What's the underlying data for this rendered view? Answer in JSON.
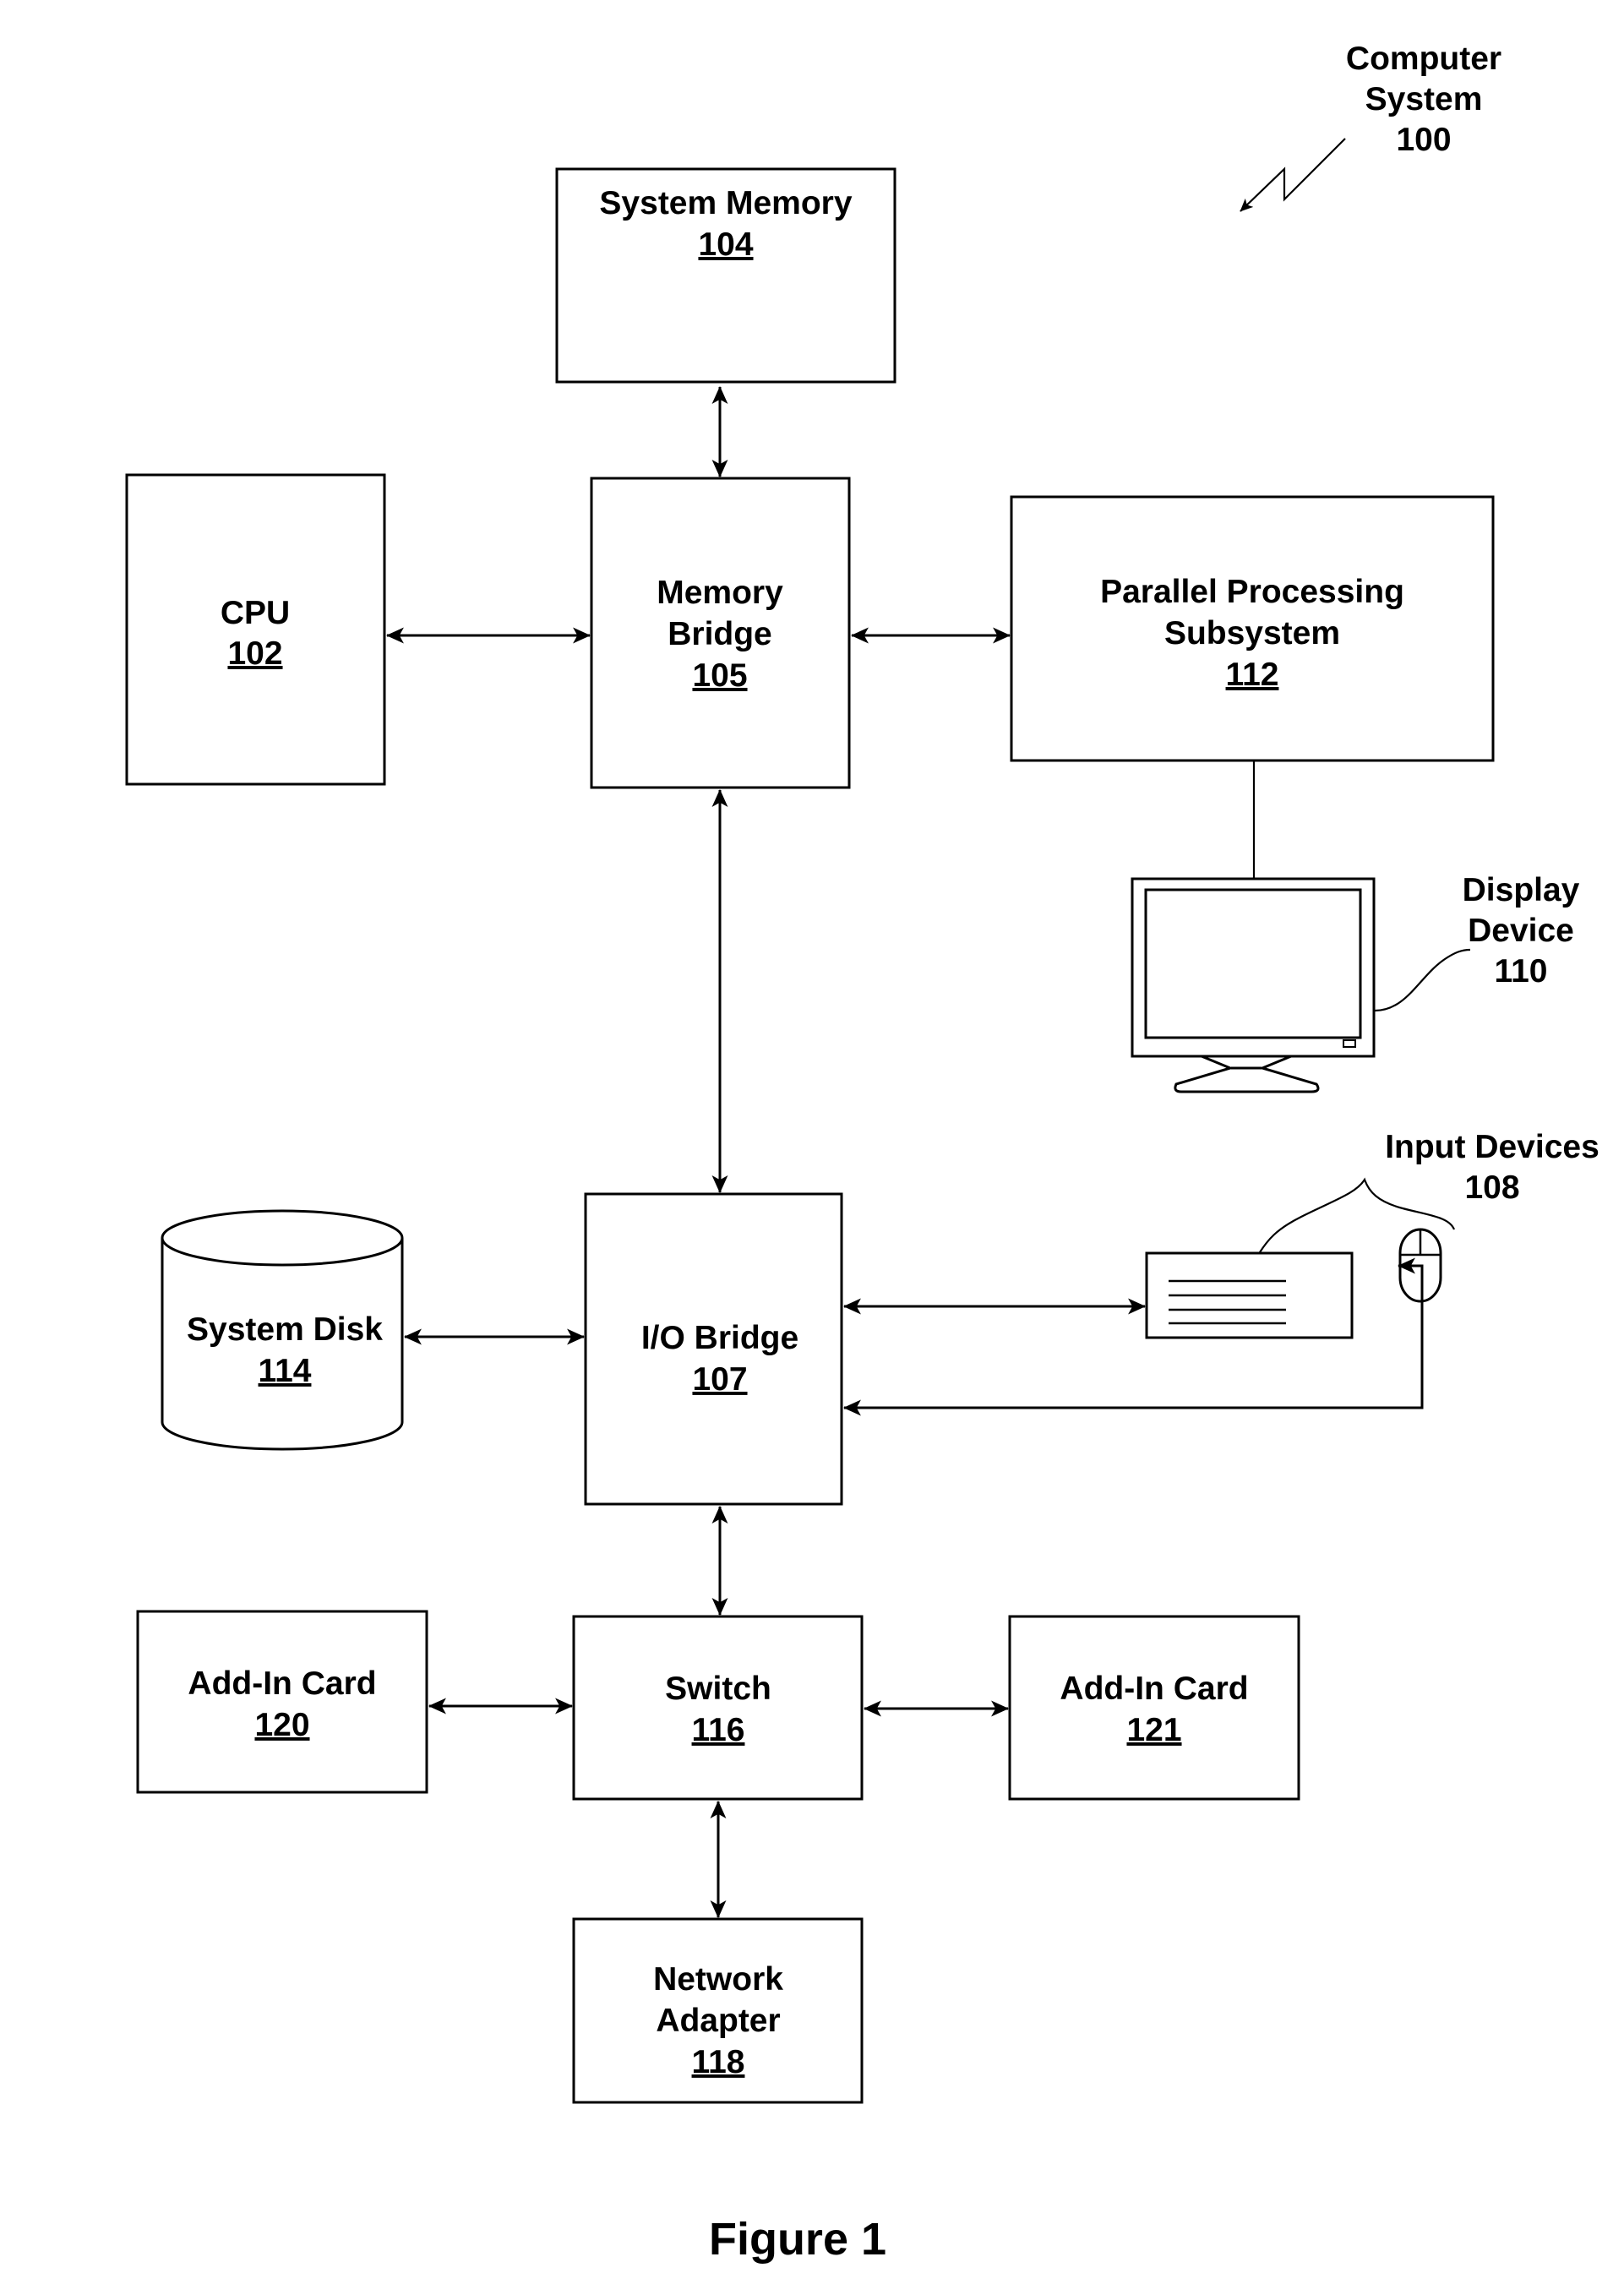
{
  "figure": {
    "caption": "Figure 1",
    "system_label_line1": "Computer",
    "system_label_line2": "System",
    "system_ref": "100"
  },
  "components": {
    "system_memory": {
      "line1": "System Memory",
      "ref": "104"
    },
    "cpu": {
      "line1": "CPU",
      "ref": "102"
    },
    "memory_bridge": {
      "line1": "Memory",
      "line2": "Bridge",
      "ref": "105"
    },
    "parallel_processing": {
      "line1": "Parallel Processing",
      "line2": "Subsystem",
      "ref": "112"
    },
    "display_device": {
      "line1": "Display",
      "line2": "Device",
      "ref": "110"
    },
    "input_devices": {
      "line1": "Input Devices",
      "ref": "108"
    },
    "system_disk": {
      "line1": "System Disk",
      "ref": "114"
    },
    "io_bridge": {
      "line1": "I/O Bridge",
      "ref": "107"
    },
    "add_in_card_120": {
      "line1": "Add-In Card",
      "ref": "120"
    },
    "switch": {
      "line1": "Switch",
      "ref": "116"
    },
    "add_in_card_121": {
      "line1": "Add-In Card",
      "ref": "121"
    },
    "network_adapter": {
      "line1": "Network",
      "line2": "Adapter",
      "ref": "118"
    }
  },
  "connections": [
    {
      "from": "System Memory 104",
      "to": "Memory Bridge 105",
      "type": "bidirectional"
    },
    {
      "from": "CPU 102",
      "to": "Memory Bridge 105",
      "type": "bidirectional"
    },
    {
      "from": "Memory Bridge 105",
      "to": "Parallel Processing Subsystem 112",
      "type": "bidirectional"
    },
    {
      "from": "Parallel Processing Subsystem 112",
      "to": "Display Device 110",
      "type": "line"
    },
    {
      "from": "Memory Bridge 105",
      "to": "I/O Bridge 107",
      "type": "bidirectional"
    },
    {
      "from": "System Disk 114",
      "to": "I/O Bridge 107",
      "type": "bidirectional"
    },
    {
      "from": "I/O Bridge 107",
      "to": "Keyboard (Input Devices 108)",
      "type": "bidirectional"
    },
    {
      "from": "Mouse (Input Devices 108)",
      "to": "I/O Bridge 107",
      "type": "bidirectional"
    },
    {
      "from": "I/O Bridge 107",
      "to": "Switch 116",
      "type": "bidirectional"
    },
    {
      "from": "Add-In Card 120",
      "to": "Switch 116",
      "type": "bidirectional"
    },
    {
      "from": "Switch 116",
      "to": "Add-In Card 121",
      "type": "bidirectional"
    },
    {
      "from": "Switch 116",
      "to": "Network Adapter 118",
      "type": "bidirectional"
    }
  ]
}
